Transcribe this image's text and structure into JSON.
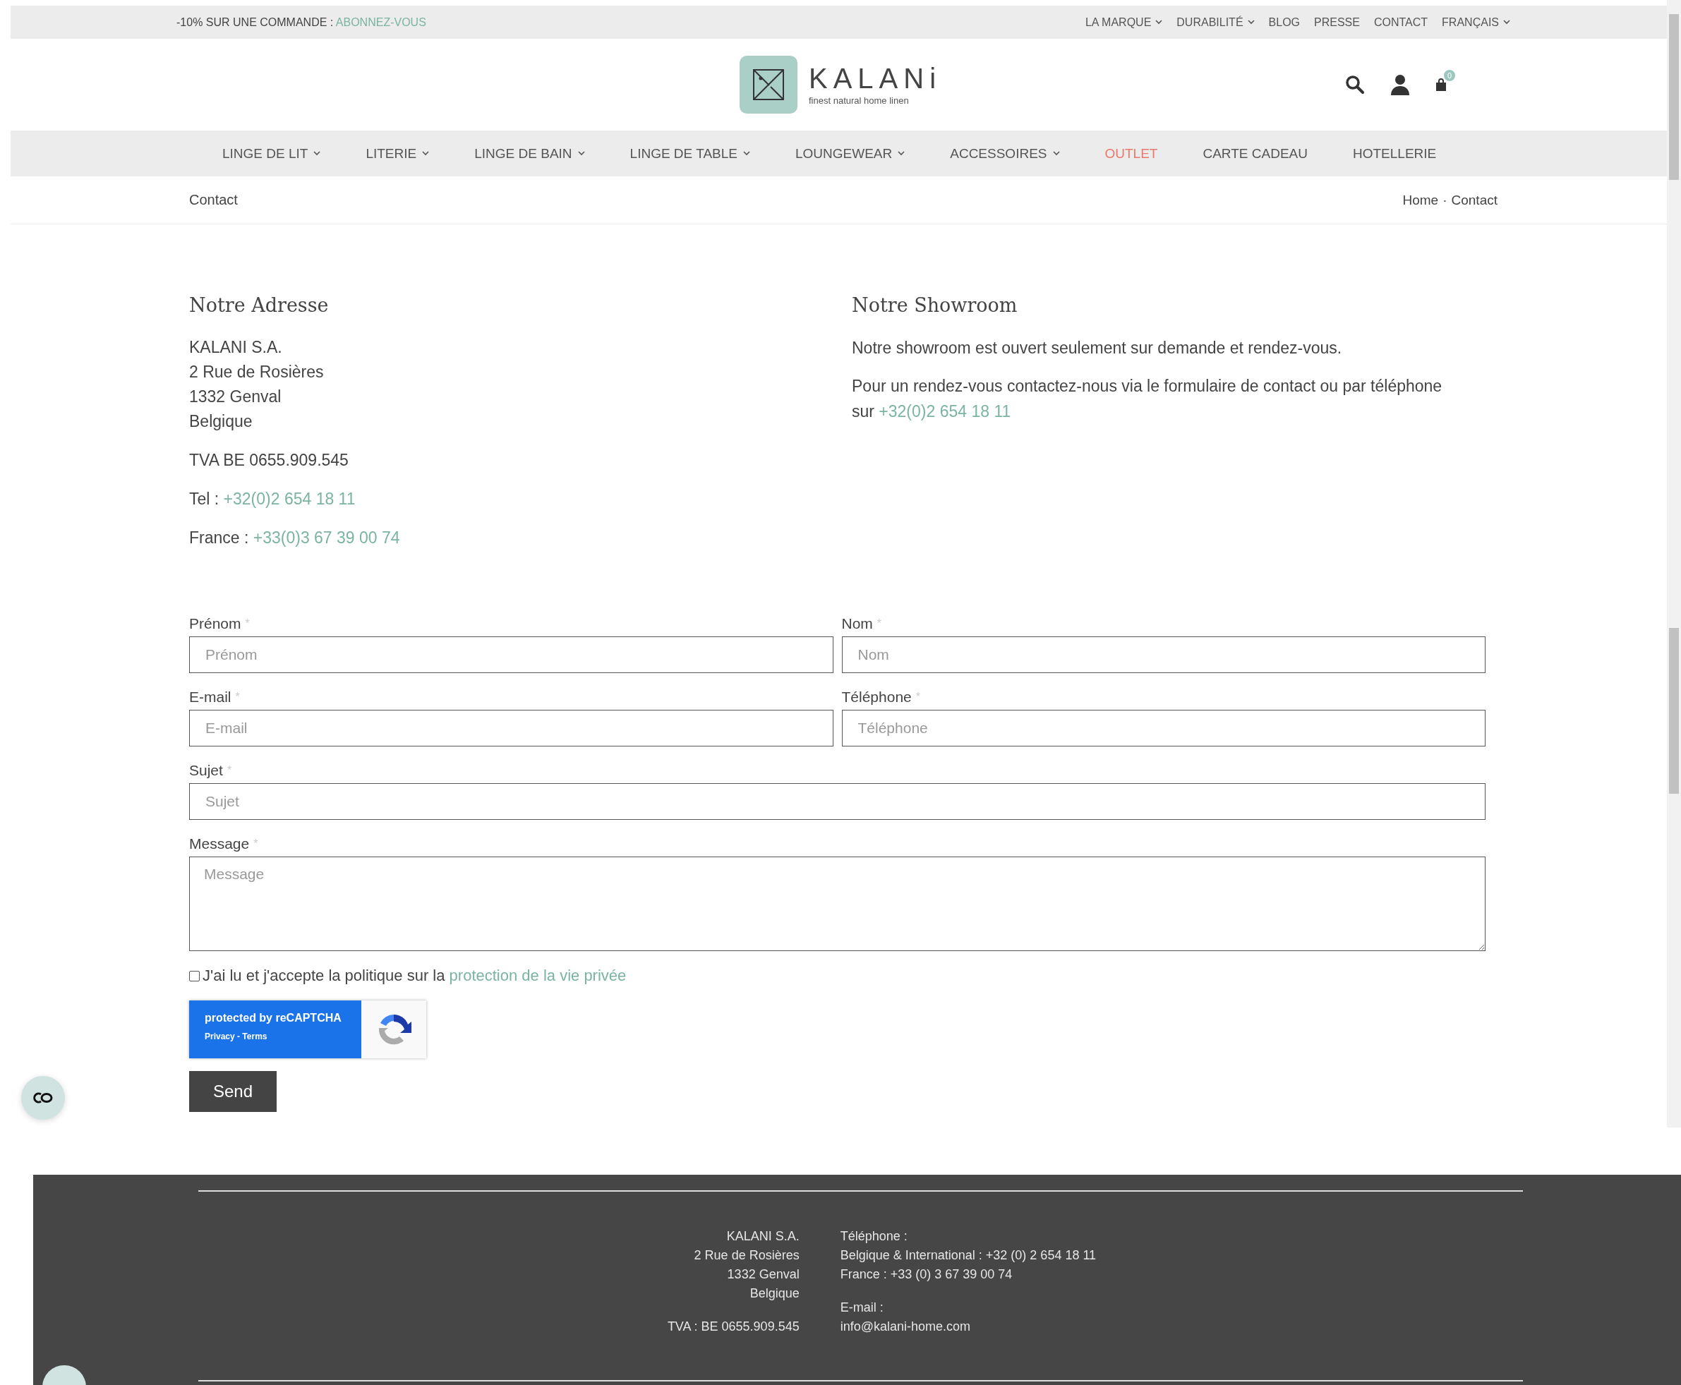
{
  "promo": {
    "text": "-10% SUR UNE COMMANDE : ",
    "link": "ABONNEZ-VOUS"
  },
  "top_links": [
    {
      "label": "LA MARQUE",
      "dropdown": true
    },
    {
      "label": "DURABILITÉ",
      "dropdown": true
    },
    {
      "label": "BLOG",
      "dropdown": false
    },
    {
      "label": "PRESSE",
      "dropdown": false
    },
    {
      "label": "CONTACT",
      "dropdown": false
    },
    {
      "label": "FRANÇAIS",
      "dropdown": true
    }
  ],
  "logo": {
    "name": "KALANi",
    "tagline": "finest natural home linen"
  },
  "cart": {
    "count": "0"
  },
  "nav": [
    {
      "label": "LINGE DE LIT",
      "dropdown": true,
      "highlight": false
    },
    {
      "label": "LITERIE",
      "dropdown": true,
      "highlight": false
    },
    {
      "label": "LINGE DE BAIN",
      "dropdown": true,
      "highlight": false
    },
    {
      "label": "LINGE DE TABLE",
      "dropdown": true,
      "highlight": false
    },
    {
      "label": "LOUNGEWEAR",
      "dropdown": true,
      "highlight": false
    },
    {
      "label": "ACCESSOIRES",
      "dropdown": true,
      "highlight": false
    },
    {
      "label": "OUTLET",
      "dropdown": false,
      "highlight": true
    },
    {
      "label": "CARTE CADEAU",
      "dropdown": false,
      "highlight": false
    },
    {
      "label": "HOTELLERIE",
      "dropdown": false,
      "highlight": false
    }
  ],
  "page_title": "Contact",
  "breadcrumb": {
    "items": [
      "Home",
      "Contact"
    ],
    "separator": "·"
  },
  "address": {
    "title": "Notre Adresse",
    "lines": [
      "KALANI S.A.",
      "2 Rue de Rosières",
      "1332 Genval",
      "Belgique"
    ],
    "vat": "TVA BE 0655.909.545",
    "phones": [
      {
        "label": "Tel : ",
        "number": "+32(0)2 654 18 11"
      },
      {
        "label": "France : ",
        "number": "+33(0)3 67 39 00 74"
      }
    ]
  },
  "showroom": {
    "title": "Notre Showroom",
    "paragraphs": [
      {
        "text": "Notre showroom est ouvert seulement sur demande et rendez-vous."
      },
      {
        "text": "Pour un rendez-vous contactez-nous via le formulaire de contact ou par téléphone sur ",
        "link": "+32(0)2 654 18 11"
      }
    ]
  },
  "form": {
    "rows": [
      [
        {
          "label": "Prénom",
          "required_mark": "*",
          "placeholder": "Prénom",
          "kind": "input"
        },
        {
          "label": "Nom",
          "required_mark": "*",
          "placeholder": "Nom",
          "kind": "input"
        }
      ],
      [
        {
          "label": "E-mail",
          "required_mark": "*",
          "placeholder": "E-mail",
          "kind": "input"
        },
        {
          "label": "Téléphone",
          "required_mark": "*",
          "placeholder": "Téléphone",
          "kind": "input"
        }
      ],
      [
        {
          "label": "Sujet",
          "required_mark": "*",
          "placeholder": "Sujet",
          "kind": "input"
        }
      ],
      [
        {
          "label": "Message",
          "required_mark": "*",
          "placeholder": "Message",
          "kind": "textarea"
        }
      ]
    ],
    "consent": {
      "checked": false,
      "text": "J'ai lu et j'accepte la politique sur la ",
      "link": "protection de la vie privée"
    },
    "recaptcha": {
      "title": "protected by reCAPTCHA",
      "links": "Privacy - Terms"
    },
    "submit": "Send"
  },
  "footer": {
    "company": [
      "KALANI S.A.",
      "2 Rue de Rosières",
      "1332 Genval",
      "Belgique"
    ],
    "vat": "TVA : BE 0655.909.545",
    "phone_title": "Téléphone :",
    "phones": [
      "Belgique & International : +32 (0) 2 654 18 11",
      "France : +33 (0) 3 67 39 00 74"
    ],
    "email_title": "E-mail :",
    "email": "info@kalani-home.com"
  }
}
